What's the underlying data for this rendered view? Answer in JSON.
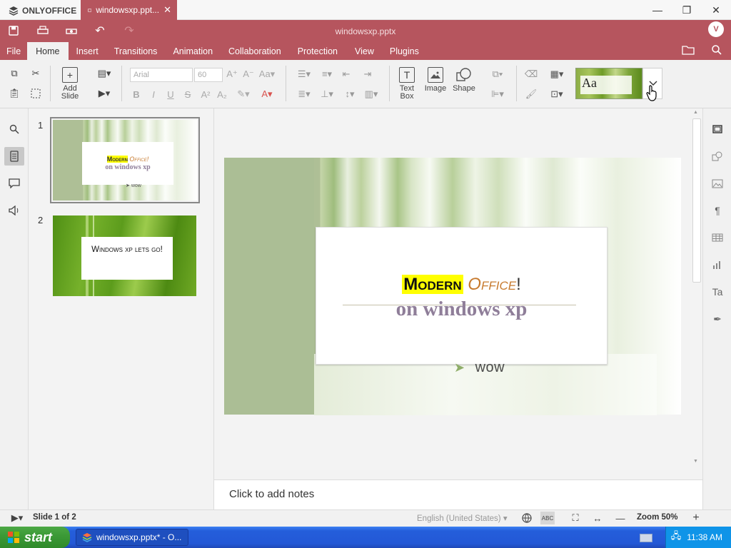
{
  "app": {
    "logo_text": "ONLYOFFICE",
    "tab_title": "windowsxp.ppt...",
    "doc_name": "windowsxp.pptx",
    "avatar_initial": "V"
  },
  "menu": [
    "File",
    "Home",
    "Insert",
    "Transitions",
    "Animation",
    "Collaboration",
    "Protection",
    "View",
    "Plugins"
  ],
  "menu_active": "Home",
  "toolbar": {
    "add_slide_label": "Add Slide",
    "font_name": "Arial",
    "font_size": "60",
    "text_box_label": "Text Box",
    "image_label": "Image",
    "shape_label": "Shape",
    "theme_sample": "Aa"
  },
  "thumbnails": [
    {
      "num": "1",
      "line1a": "Modern",
      "line1b": "Office!",
      "line2": "on windows xp",
      "bullet": "wow"
    },
    {
      "num": "2",
      "title": "Windows xp lets go!"
    }
  ],
  "slide": {
    "title_highlight": "Modern",
    "title_orange": "Office",
    "title_bang": "!",
    "subtitle": "on windows xp",
    "bullet": "wow"
  },
  "notes_placeholder": "Click to add notes",
  "status": {
    "slide_count": "Slide 1 of 2",
    "language": "English (United States)",
    "zoom": "Zoom 50%"
  },
  "taskbar": {
    "start": "start",
    "task_item": "windowsxp.pptx* - O...",
    "clock": "11:38 AM"
  },
  "colors": {
    "brand": "#b6555e",
    "highlight": "#ffff00",
    "title_orange": "#c77a2e",
    "subtitle": "#8f7e99"
  }
}
